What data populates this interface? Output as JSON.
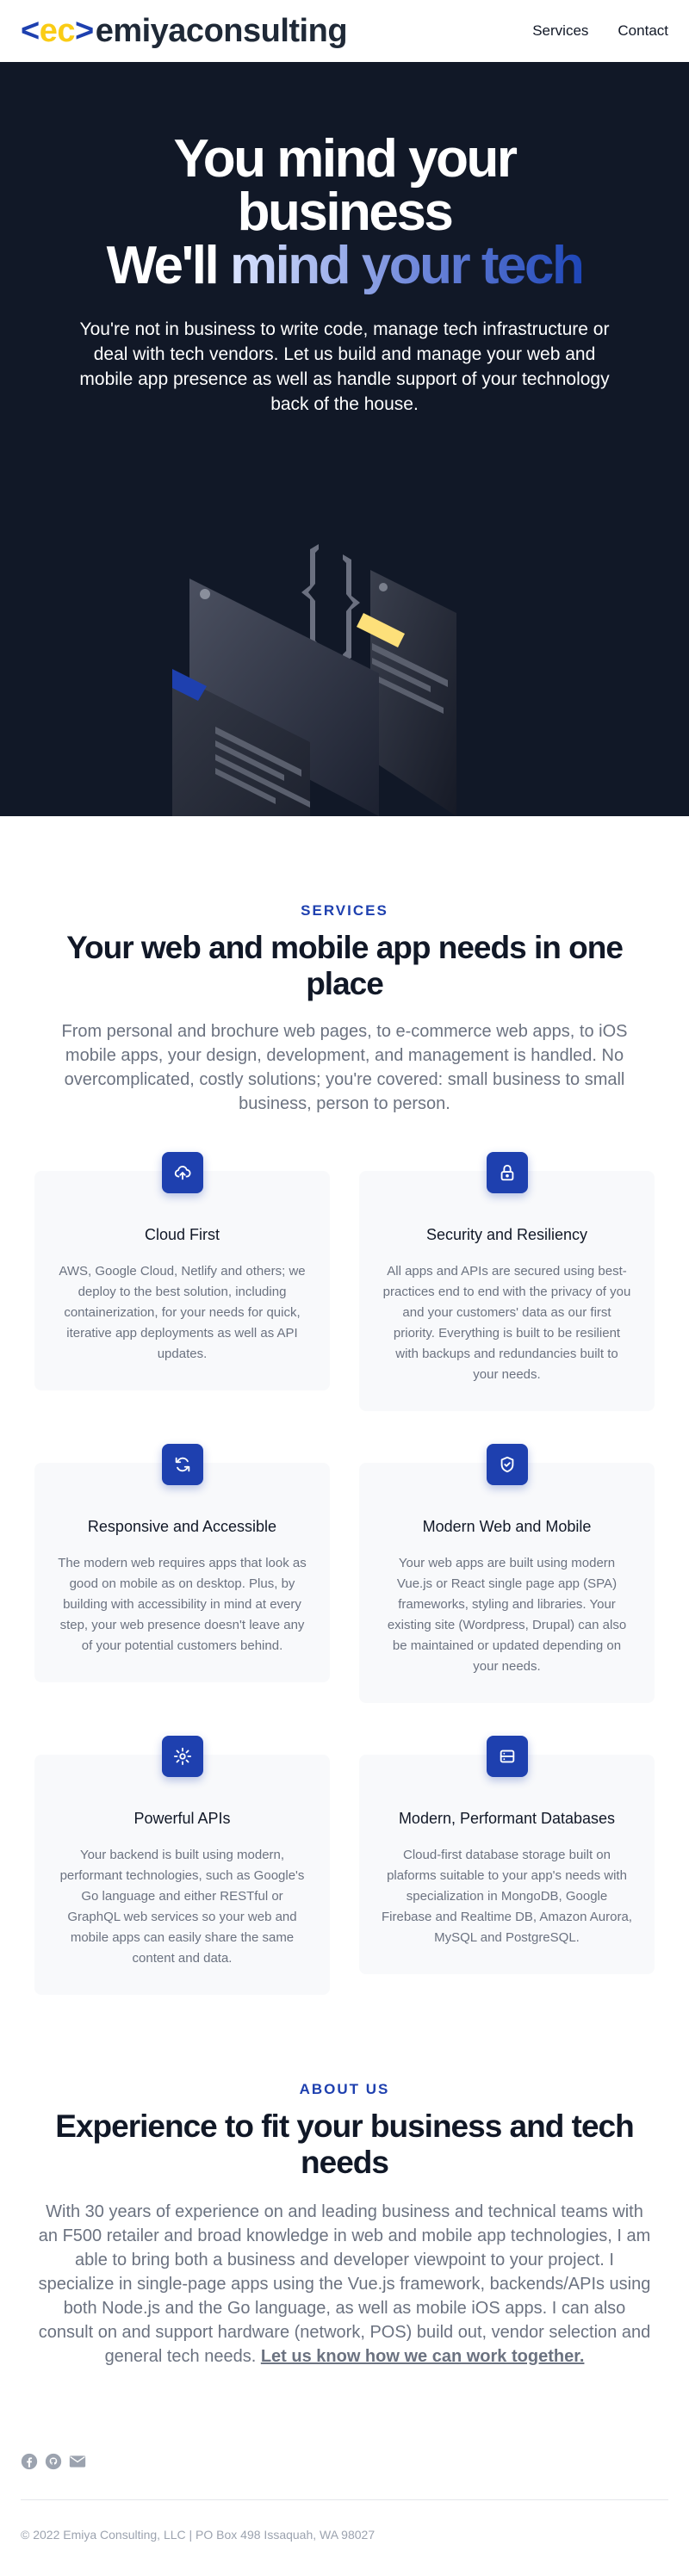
{
  "header": {
    "logo": {
      "open": "<",
      "ec": "ec",
      "close": ">",
      "name": "emiyaconsulting"
    },
    "nav": [
      {
        "label": "Services"
      },
      {
        "label": "Contact"
      }
    ]
  },
  "hero": {
    "title_line1": "You mind your",
    "title_line2": "business",
    "title_line3_a": "We'll ",
    "title_line3_b": "mind your tech",
    "subtitle": "You're not in business to write code, manage tech infrastructure or deal with tech vendors. Let us build and manage your web and mobile app presence as well as handle support of your technology back of the house."
  },
  "services": {
    "eyebrow": "SERVICES",
    "title": "Your web and mobile app needs in one place",
    "lead": "From personal and brochure web pages, to e-commerce web apps, to iOS mobile apps, your design, development, and management is handled. No overcomplicated, costly solutions; you're covered: small business to small business, person to person.",
    "cards": [
      {
        "icon": "cloud-upload-icon",
        "title": "Cloud First",
        "text": "AWS, Google Cloud, Netlify and others; we deploy to the best solution, including containerization, for your needs for quick, iterative app deployments as well as API updates."
      },
      {
        "icon": "lock-icon",
        "title": "Security and Resiliency",
        "text": "All apps and APIs are secured using best-practices end to end with the privacy of you and your customers' data as our first priority. Everything is built to be resilient with backups and redundancies built to your needs."
      },
      {
        "icon": "refresh-icon",
        "title": "Responsive and Accessible",
        "text": "The modern web requires apps that look as good on mobile as on desktop. Plus, by building with accessibility in mind at every step, your web presence doesn't leave any of your potential customers behind."
      },
      {
        "icon": "shield-check-icon",
        "title": "Modern Web and Mobile",
        "text": "Your web apps are built using modern Vue.js or React single page app (SPA) frameworks, styling and libraries. Your existing site (Wordpress, Drupal) can also be maintained or updated depending on your needs."
      },
      {
        "icon": "gear-icon",
        "title": "Powerful APIs",
        "text": "Your backend is built using modern, performant technologies, such as Google's Go language and either RESTful or GraphQL web services so your web and mobile apps can easily share the same content and data."
      },
      {
        "icon": "server-icon",
        "title": "Modern, Performant Databases",
        "text": "Cloud-first database storage built on plaforms suitable to your app's needs with specialization in MongoDB, Google Firebase and Realtime DB, Amazon Aurora, MySQL and PostgreSQL."
      }
    ]
  },
  "about": {
    "eyebrow": "ABOUT US",
    "title": "Experience to fit your business and tech needs",
    "text": "With 30 years of experience on and leading business and technical teams with an F500 retailer and broad knowledge in web and mobile app technologies, I am able to bring both a business and developer viewpoint to your project. I specialize in single-page apps using the Vue.js framework, backends/APIs using both Node.js and the Go language, as well as mobile iOS apps. I can also consult on and support hardware (network, POS) build out, vendor selection and general tech needs.",
    "link": "Let us know how we can work together."
  },
  "footer": {
    "socials": [
      "facebook-icon",
      "github-icon",
      "mail-icon"
    ],
    "copyright": "© 2022 Emiya Consulting, LLC | PO Box 498 Issaquah, WA 98027"
  },
  "colors": {
    "brand_blue": "#1e40af",
    "brand_yellow": "#facc15",
    "hero_bg": "#111827"
  }
}
